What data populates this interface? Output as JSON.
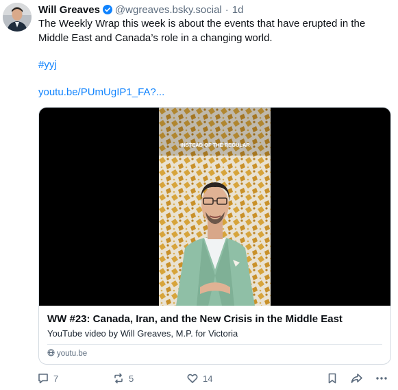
{
  "post": {
    "author_name": "Will Greaves",
    "author_handle": "@wgreaves.bsky.social",
    "separator": "·",
    "time": "1d",
    "text": "The Weekly Wrap this week is about the events that have erupted in the Middle East and Canada’s role in a changing world.",
    "hashtag": "#yyj",
    "link": "youtu.be/PUmUgIP1_FA?..."
  },
  "embed": {
    "video_overlay_text": "INSTEAD OF THE REGULAR",
    "title": "WW #23: Canada, Iran, and the New Crisis in the Middle East",
    "description": "YouTube video by Will Greaves, M.P. for Victoria",
    "domain": "youtu.be"
  },
  "actions": {
    "reply_count": "7",
    "repost_count": "5",
    "like_count": "14"
  },
  "colors": {
    "accent": "#1083fe",
    "muted": "#5b6b7d",
    "border": "#d4dbe2"
  },
  "icons": [
    "verified-icon",
    "reply-icon",
    "repost-icon",
    "like-icon",
    "bookmark-icon",
    "share-icon",
    "more-icon",
    "globe-icon"
  ]
}
